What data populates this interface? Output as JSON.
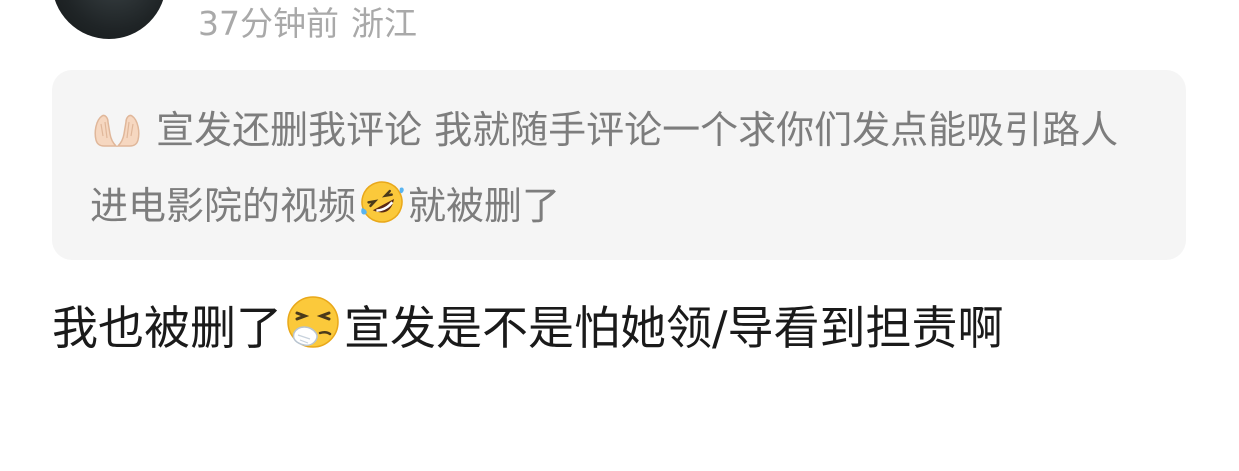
{
  "comment": {
    "time_ago": "37分钟前",
    "location": "浙江"
  },
  "quoted_reply": {
    "icon": "open-hands-icon",
    "text_1": "宣发还删我评论 我就随手评论一个求你们发点能吸引路人进电影院的视频",
    "icon_2": "rolling-on-floor-laughing-icon",
    "text_2": "就被删了"
  },
  "reply": {
    "text_1": "我也被删了",
    "icon": "sneezing-face-icon",
    "text_2": "宣发是不是怕她领/导看到担责啊"
  },
  "colors": {
    "meta_gray": "#a9a9a9",
    "quote_bg": "#f5f5f5",
    "quote_text": "#7d7d7d",
    "reply_text": "#1a1a1a"
  }
}
